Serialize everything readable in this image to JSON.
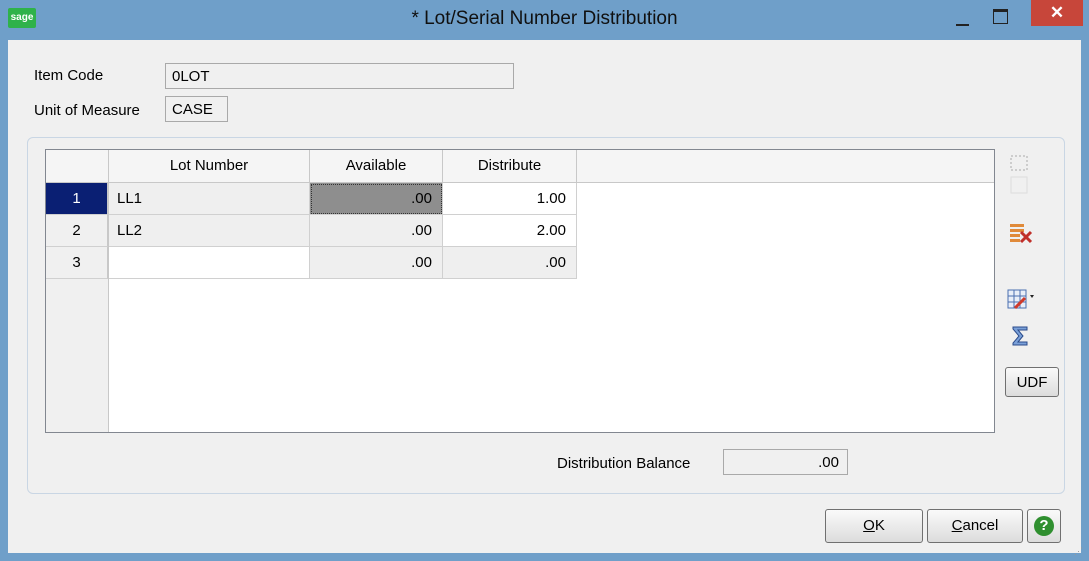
{
  "window": {
    "title": "* Lot/Serial Number Distribution",
    "logo_text": "sage",
    "minimize_label": "—",
    "close_label": "✕"
  },
  "header": {
    "item_code_label": "Item Code",
    "item_code_value": "0LOT",
    "uom_label": "Unit of Measure",
    "uom_value": "CASE"
  },
  "grid": {
    "columns": [
      "Lot Number",
      "Available",
      "Distribute"
    ],
    "rows": [
      {
        "num": "1",
        "lot": "LL1",
        "available": ".00",
        "distribute": "1.00"
      },
      {
        "num": "2",
        "lot": "LL2",
        "available": ".00",
        "distribute": "2.00"
      },
      {
        "num": "3",
        "lot": "",
        "available": ".00",
        "distribute": ".00"
      }
    ]
  },
  "side_tools": {
    "udf_label": "UDF",
    "icons": [
      "insert-row-icon",
      "delete-row-icon",
      "customize-grid-icon",
      "totals-icon"
    ]
  },
  "footer": {
    "balance_label": "Distribution Balance",
    "balance_value": ".00"
  },
  "buttons": {
    "ok_mnemonic": "O",
    "ok_rest": "K",
    "cancel_mnemonic": "C",
    "cancel_rest": "ancel",
    "help_label": "?"
  },
  "colors": {
    "titlebar": "#6f9fc9",
    "selected_row": "#0a1f73",
    "close_button": "#c7463a"
  }
}
